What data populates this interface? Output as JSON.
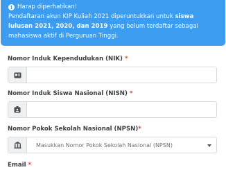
{
  "alert": {
    "title": "Harap diperhatikan!",
    "line1_a": "Pendaftaran akun KIP Kuliah 2021 diperuntukkan untuk ",
    "line1_b": "siswa",
    "line2_a": "lulusan 2021, 2020, dan 2019",
    "line2_b": " yang belum terdaftar sebagai",
    "line3": "mahasiswa aktif di Perguruan Tinggi.",
    "color": "#3b9cf0"
  },
  "form": {
    "nik": {
      "label": "Nomor Induk Kependudukan (NIK)",
      "required": "*",
      "icon": "id-card-icon",
      "value": ""
    },
    "nisn": {
      "label": "Nomor Induk Siswa Nasional (NISN)",
      "required": "*",
      "icon": "id-badge-icon",
      "value": ""
    },
    "npsn": {
      "label": "Nomor Pokok Sekolah Nasional (NPSN)",
      "required": "*",
      "icon": "school-icon",
      "placeholder": "Masukkan Nomor Pokok Sekolah Nasional (NPSN)"
    },
    "email": {
      "label": "Email",
      "required": "*"
    }
  }
}
